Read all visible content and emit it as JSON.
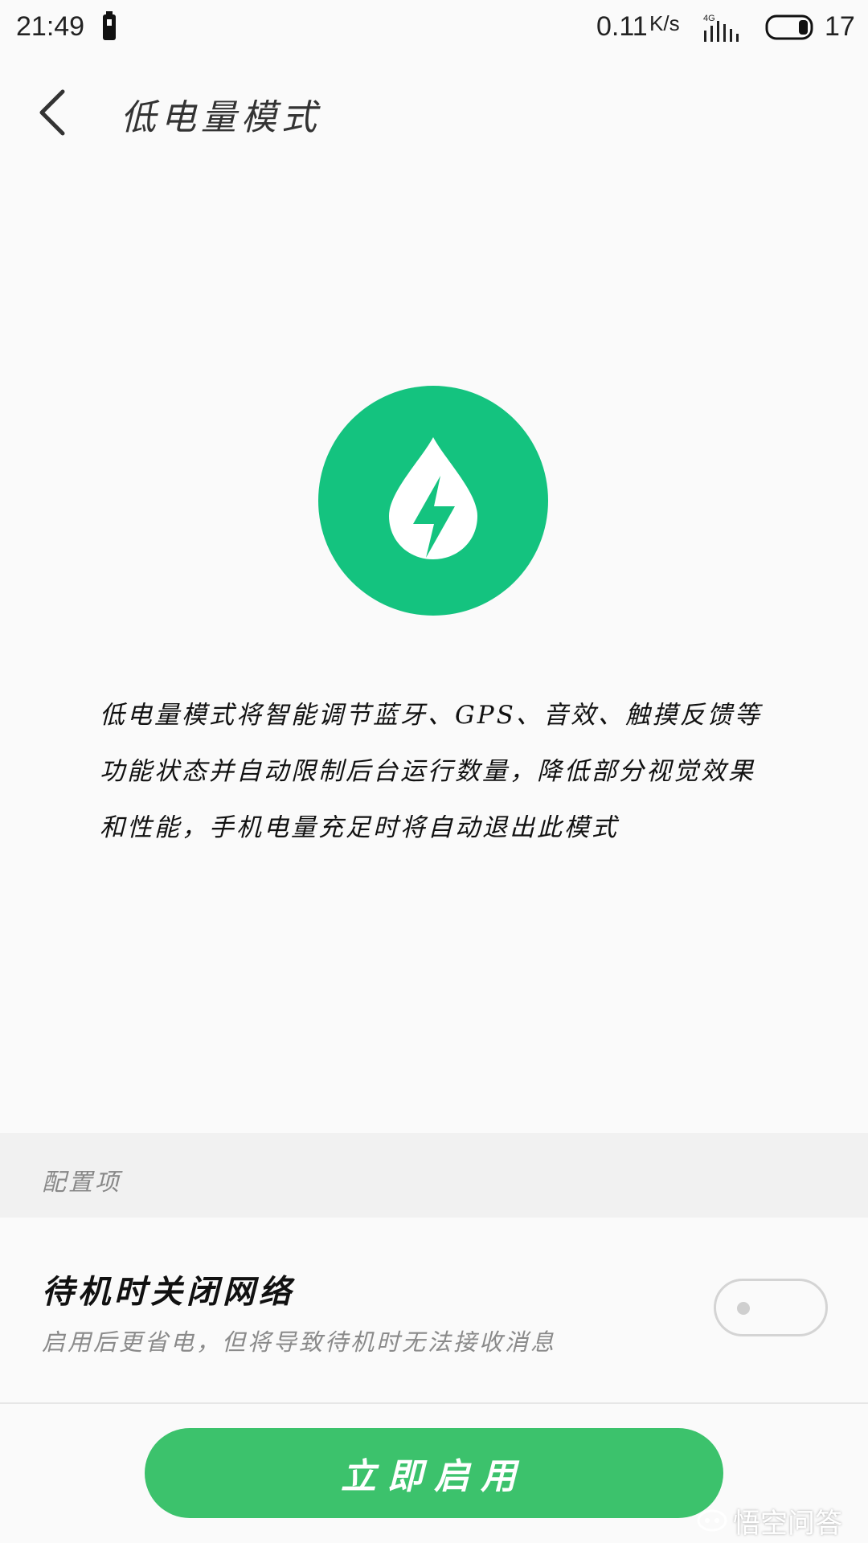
{
  "status_bar": {
    "time": "21:49",
    "net_speed": "0.11",
    "net_speed_unit": "K/s",
    "network_type": "4G",
    "battery_level": "17"
  },
  "header": {
    "title": "低电量模式"
  },
  "hero": {
    "icon": "lightning-drop-icon",
    "accent_color": "#14c37f"
  },
  "description": "低电量模式将智能调节蓝牙、GPS、音效、触摸反馈等功能状态并自动限制后台运行数量，降低部分视觉效果和性能，手机电量充足时将自动退出此模式",
  "config": {
    "section_title": "配置项",
    "settings": [
      {
        "title": "待机时关闭网络",
        "subtitle": "启用后更省电，但将导致待机时无法接收消息",
        "enabled": false
      }
    ]
  },
  "action": {
    "enable_label": "立即启用",
    "color": "#3cc26c"
  },
  "watermark": {
    "text": "悟空问答"
  }
}
